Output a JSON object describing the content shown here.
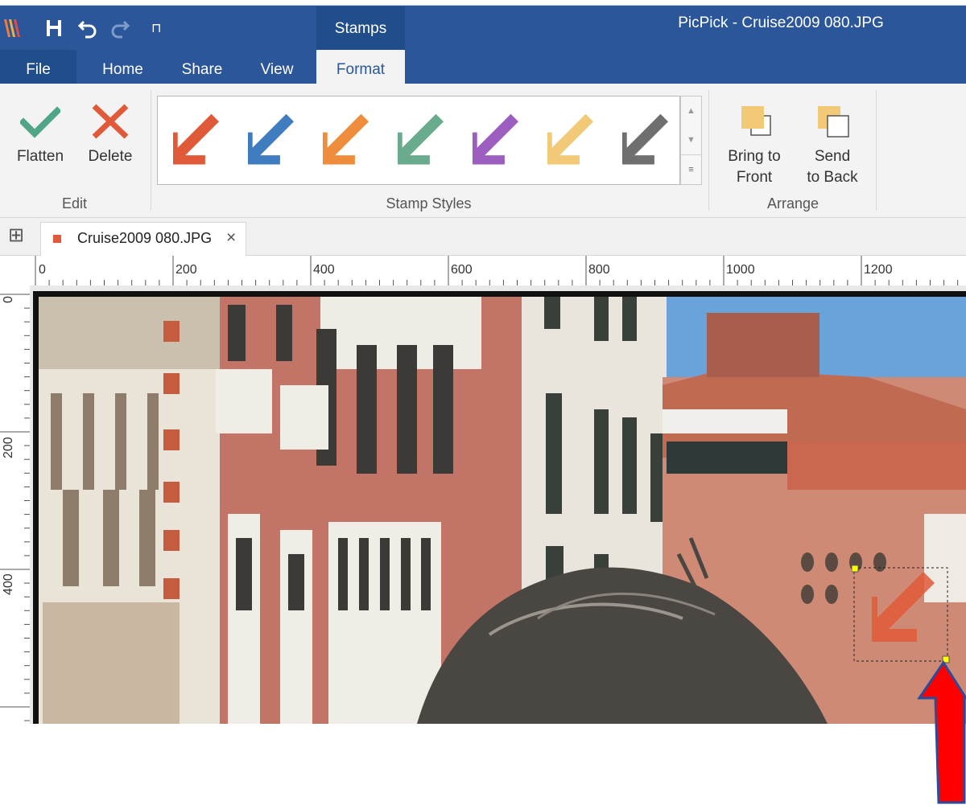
{
  "app": {
    "window_title": "PicPick - Cruise2009 080.JPG",
    "context_tab": "Stamps"
  },
  "quick_access": {
    "icons": [
      "app-logo-icon",
      "save-icon",
      "undo-icon",
      "redo-icon",
      "customize-icon"
    ],
    "customize_glyph": "⊓"
  },
  "tabs": [
    {
      "label": "File"
    },
    {
      "label": "Home"
    },
    {
      "label": "Share"
    },
    {
      "label": "View"
    },
    {
      "label": "Format"
    }
  ],
  "ribbon": {
    "edit": {
      "flatten_label": "Flatten",
      "delete_label": "Delete",
      "group_label": "Edit"
    },
    "stamp_styles": {
      "group_label": "Stamp Styles",
      "colors": [
        "#e05a3a",
        "#3f7cc0",
        "#ee8e3c",
        "#6aab8e",
        "#9c5fbf",
        "#f1c977",
        "#6f6f6f"
      ]
    },
    "arrange": {
      "bring_front_line1": "Bring to",
      "bring_front_line2": "Front",
      "send_back_line1": "Send",
      "send_back_line2": "to Back",
      "group_label": "Arrange"
    }
  },
  "document": {
    "tab_label": "Cruise2009 080.JPG",
    "close_glyph": "×",
    "grid_glyph": "⊞"
  },
  "rulers": {
    "horizontal": [
      "0",
      "200",
      "400",
      "600",
      "800",
      "1000",
      "1200"
    ],
    "vertical": [
      "0",
      "200",
      "400"
    ]
  },
  "colors": {
    "ribbon_blue": "#2b579a",
    "stamp_selected": "#e05a3a",
    "annotation_arrow": "#ff0000",
    "annotation_outline": "#2a4c9a",
    "selection_handle": "#ffff00"
  }
}
